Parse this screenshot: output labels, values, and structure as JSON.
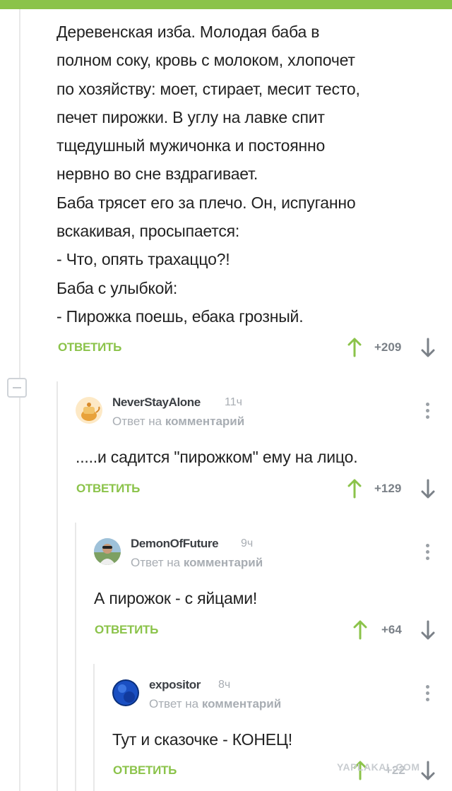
{
  "colors": {
    "accent": "#8bc34a",
    "text": "#222222",
    "muted": "#a8adb3"
  },
  "root_comment": {
    "text": "Деревенская изба. Молодая баба в\nполном соку, кровь с молоком, хлопочет\nпо хозяйству: моет, стирает, месит тесто,\nпечет пирожки. В углу на лавке спит\nтщедушный мужичонка и постоянно\nнервно во сне вздрагивает.\nБаба трясет его за плечо. Он, испуганно\nвскакивая, просыпается:\n- Что, опять трахаццо?!\nБаба с улыбкой:\n- Пирожка поешь, ебака грозный.",
    "reply_label": "ОТВЕТИТЬ",
    "rating": "+209"
  },
  "replies": [
    {
      "username": "NeverStayAlone",
      "time": "11ч",
      "meta_prefix": "Ответ на",
      "meta_link": "комментарий",
      "text": ".....и садится \"пирожком\" ему на лицо.",
      "reply_label": "ОТВЕТИТЬ",
      "rating": "+129",
      "avatar_icon": "teapot-avatar-icon"
    },
    {
      "username": "DemonOfFuture",
      "time": "9ч",
      "meta_prefix": "Ответ на",
      "meta_link": "комментарий",
      "text": "А пирожок - с яйцами!",
      "reply_label": "ОТВЕТИТЬ",
      "rating": "+64",
      "avatar_icon": "person-avatar-icon"
    },
    {
      "username": "expositor",
      "time": "8ч",
      "meta_prefix": "Ответ на",
      "meta_link": "комментарий",
      "text": "Тут и сказочке - КОНЕЦ!",
      "reply_label": "ОТВЕТИТЬ",
      "rating": "+22",
      "avatar_icon": "blue-sphere-avatar-icon"
    }
  ],
  "watermark": "YAPLAKAL.COM"
}
